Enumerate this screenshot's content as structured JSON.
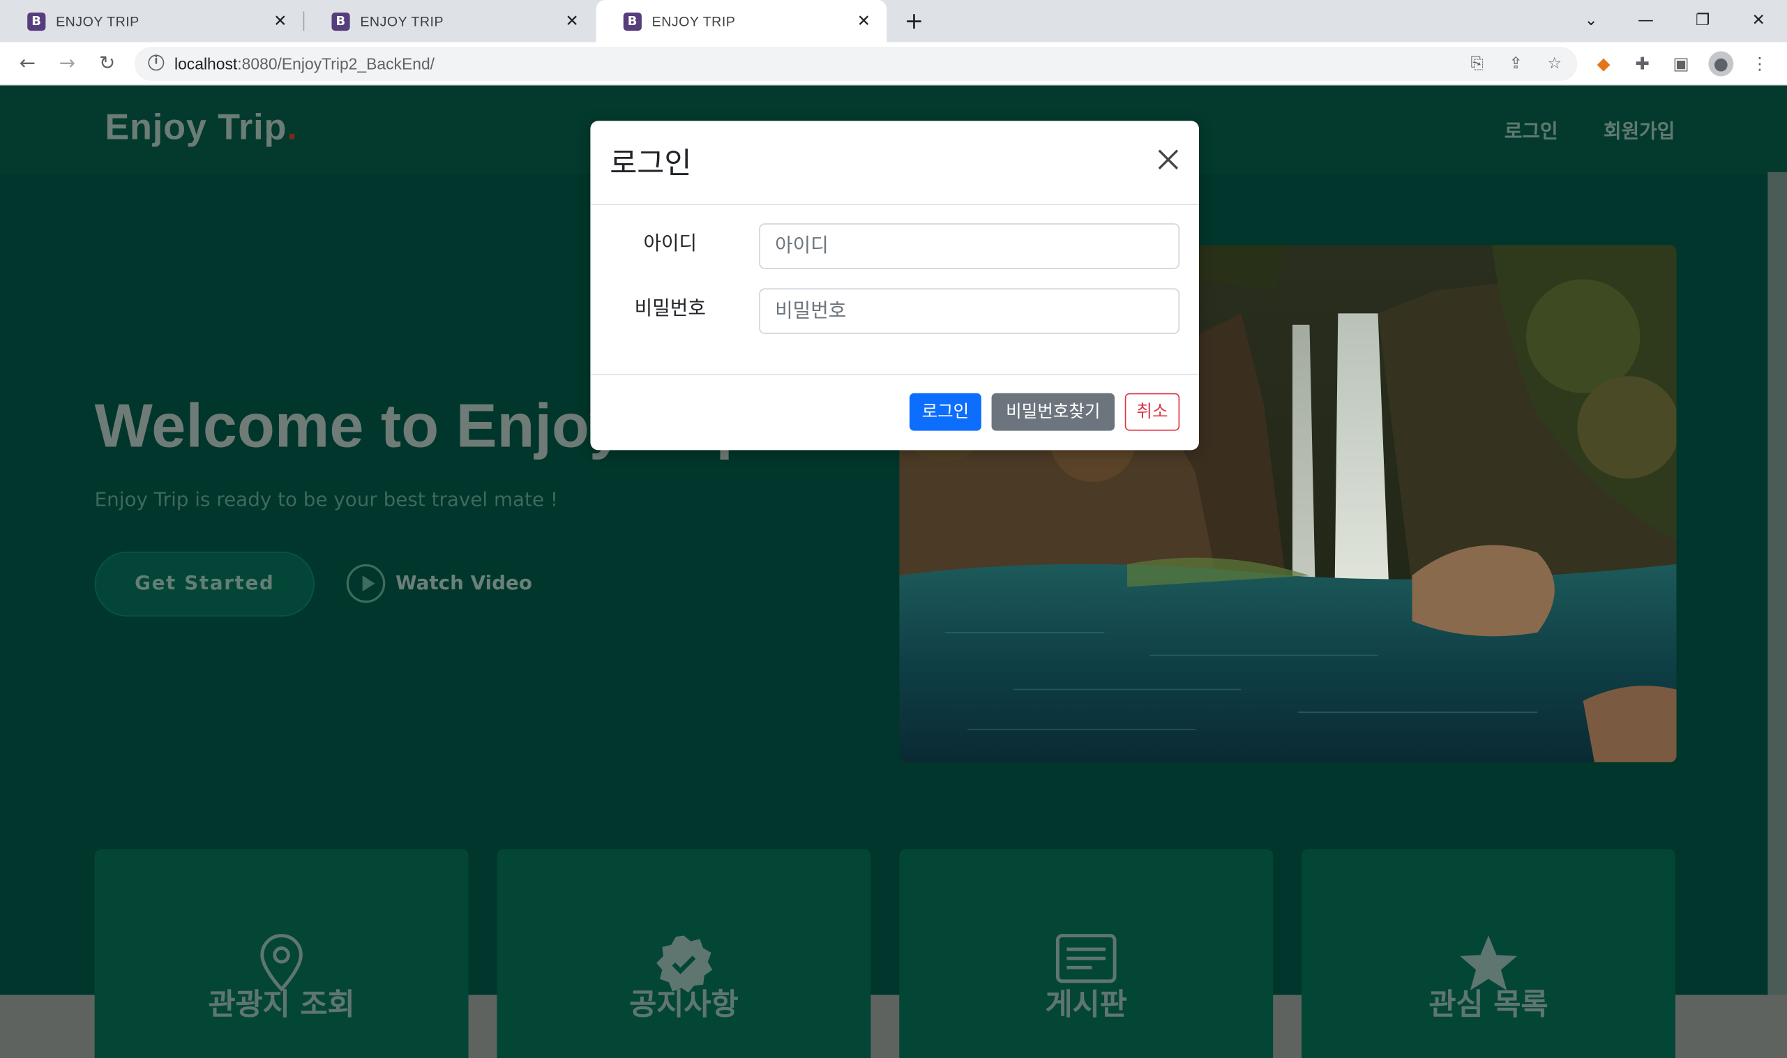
{
  "browser": {
    "tabs": [
      {
        "label": "ENJOY TRIP",
        "favicon": "B"
      },
      {
        "label": "ENJOY TRIP",
        "favicon": "B"
      },
      {
        "label": "ENJOY TRIP",
        "favicon": "B"
      }
    ],
    "url_host": "localhost",
    "url_path": ":8080/EnjoyTrip2_BackEnd/"
  },
  "header": {
    "logo": "Enjoy Trip",
    "logo_dot": ".",
    "nav": {
      "login": "로그인",
      "signup": "회원가입"
    }
  },
  "hero": {
    "title": "Welcome to Enjoy Trip",
    "subtitle": "Enjoy Trip is ready to be your best travel mate !",
    "get_started": "Get Started",
    "watch_video": "Watch Video"
  },
  "cards": [
    {
      "label": "관광지 조회",
      "icon": "map-pin-icon"
    },
    {
      "label": "공지사항",
      "icon": "verified-badge-icon"
    },
    {
      "label": "게시판",
      "icon": "board-icon"
    },
    {
      "label": "관심 목록",
      "icon": "star-icon"
    }
  ],
  "modal": {
    "title": "로그인",
    "id_label": "아이디",
    "id_placeholder": "아이디",
    "pw_label": "비밀번호",
    "pw_placeholder": "비밀번호",
    "login_btn": "로그인",
    "find_pw_btn": "비밀번호찾기",
    "cancel_btn": "취소"
  },
  "colors": {
    "primary": "#0d6efd",
    "secondary": "#6c757d",
    "danger": "#dc3545",
    "page_bg_dimmed": "#01362a"
  }
}
